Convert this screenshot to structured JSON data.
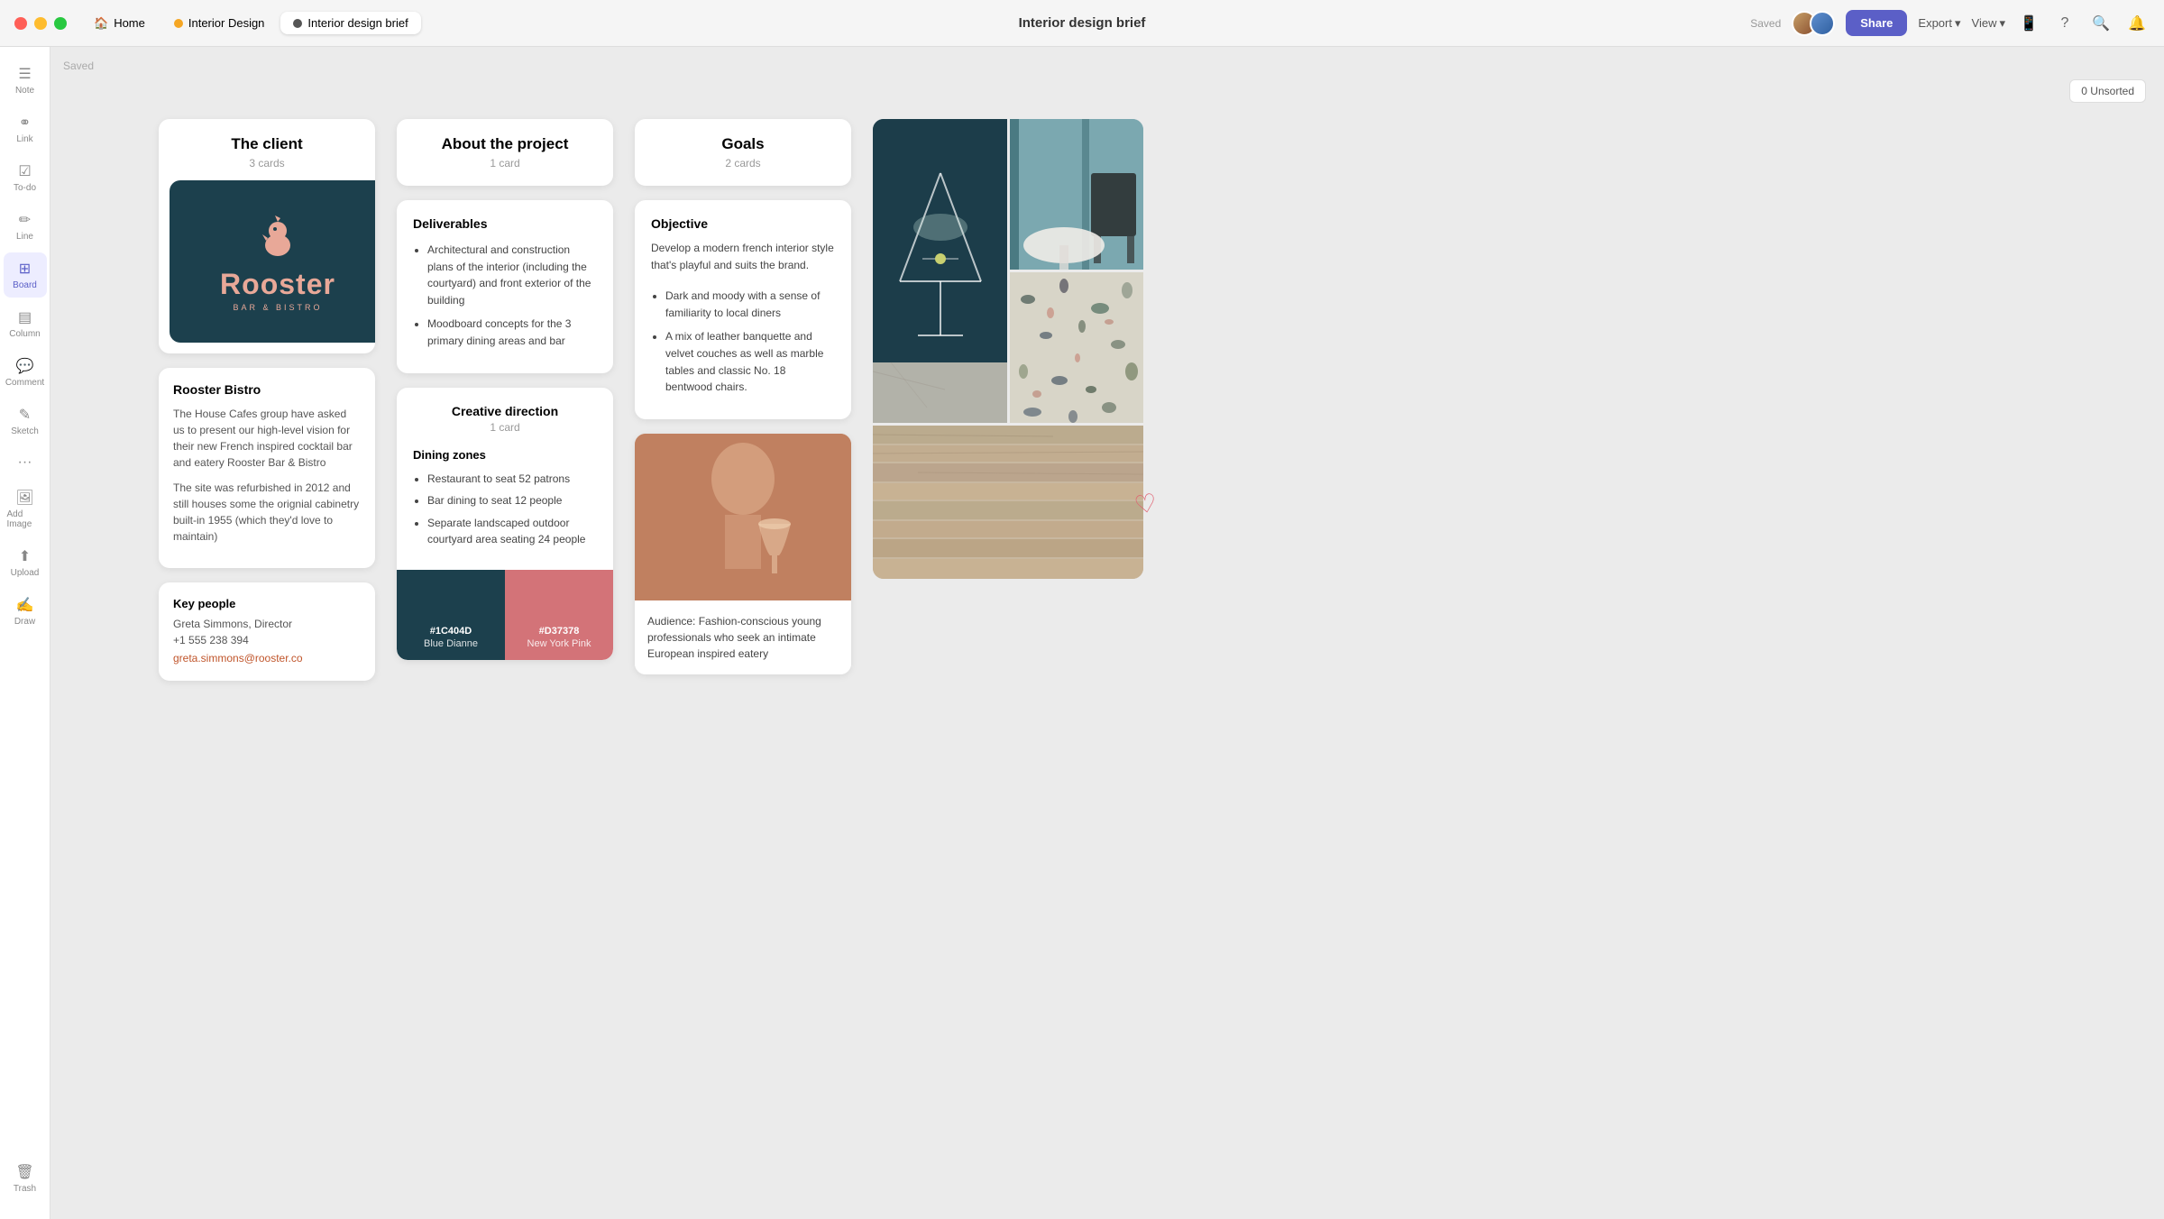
{
  "titlebar": {
    "title": "Interior design brief",
    "saved_label": "Saved",
    "tabs": [
      {
        "id": "home",
        "label": "Home",
        "icon": "🏠",
        "color": null,
        "dot_color": null
      },
      {
        "id": "interior-design",
        "label": "Interior Design",
        "dot_color": "#f5a623"
      },
      {
        "id": "interior-brief",
        "label": "Interior design brief",
        "dot_color": "#555",
        "active": true
      }
    ],
    "share_label": "Share",
    "export_label": "Export",
    "view_label": "View",
    "unsorted_label": "0 Unsorted",
    "notification_count": "0"
  },
  "sidebar": {
    "items": [
      {
        "id": "note",
        "icon": "☰",
        "label": "Note"
      },
      {
        "id": "link",
        "icon": "🔗",
        "label": "Link"
      },
      {
        "id": "todo",
        "icon": "✔",
        "label": "To-do"
      },
      {
        "id": "line",
        "icon": "✏",
        "label": "Line"
      },
      {
        "id": "board",
        "icon": "⊞",
        "label": "Board",
        "active": true
      },
      {
        "id": "column",
        "icon": "▤",
        "label": "Column"
      },
      {
        "id": "comment",
        "icon": "💬",
        "label": "Comment"
      },
      {
        "id": "sketch",
        "icon": "✎",
        "label": "Sketch"
      },
      {
        "id": "more",
        "icon": "•••",
        "label": ""
      },
      {
        "id": "add-image",
        "icon": "🖼",
        "label": "Add Image"
      },
      {
        "id": "upload",
        "icon": "⬆",
        "label": "Upload"
      },
      {
        "id": "draw",
        "icon": "✍",
        "label": "Draw"
      }
    ],
    "trash_label": "Trash"
  },
  "client_column": {
    "title": "The client",
    "card_count": "3 cards",
    "logo": {
      "brand": "Rooster",
      "tagline": "BAR & BISTRO",
      "bg_color": "#1c404d",
      "text_color": "#e8a898"
    },
    "info": {
      "name": "Rooster Bistro",
      "description1": "The House Cafes group have asked us to present our high-level vision for their new French inspired cocktail bar and eatery Rooster Bar & Bistro",
      "description2": "The site was refurbished in 2012 and still houses some the orignial cabinetry built-in 1955 (which they'd love to maintain)"
    },
    "key_people": {
      "title": "Key people",
      "name": "Greta Simmons, Director",
      "phone": "+1 555 238 394",
      "email": "greta.simmons@rooster.co"
    }
  },
  "project_column": {
    "title": "About the project",
    "card_count": "1 card",
    "deliverables": {
      "title": "Deliverables",
      "items": [
        "Architectural and construction plans of the interior (including the courtyard) and front exterior of the building",
        "Moodboard concepts for the 3 primary dining areas and bar"
      ]
    },
    "creative_direction": {
      "header_title": "Creative direction",
      "header_count": "1 card",
      "dining_title": "Dining zones",
      "dining_items": [
        "Restaurant to seat 52 patrons",
        "Bar dining to seat 12 people",
        "Separate landscaped outdoor courtyard area seating 24 people"
      ]
    },
    "colors": [
      {
        "hex": "#1C404D",
        "label": "#1C404D",
        "name": "Blue Dianne"
      },
      {
        "hex": "#D37378",
        "label": "#D37378",
        "name": "New York Pink"
      }
    ]
  },
  "goals_column": {
    "title": "Goals",
    "card_count": "2 cards",
    "objective": {
      "title": "Objective",
      "description": "Develop a modern french interior style that's playful and suits the brand.",
      "items": [
        "Dark and moody with a sense of familiarity to local diners",
        "A mix of leather banquette and velvet couches as well as marble tables and classic No. 18 bentwood chairs."
      ]
    },
    "audience": {
      "caption": "Audience: Fashion-conscious young professionals who seek an intimate European inspired eatery"
    }
  },
  "moodboard": {
    "heart_icon": "♡",
    "colors": {
      "img1_bg": "#1c4a5a",
      "img2_bg": "#7a9fa8",
      "img3_bg": "#b8b8b0",
      "img4_bg": "#c8c0b0"
    }
  }
}
